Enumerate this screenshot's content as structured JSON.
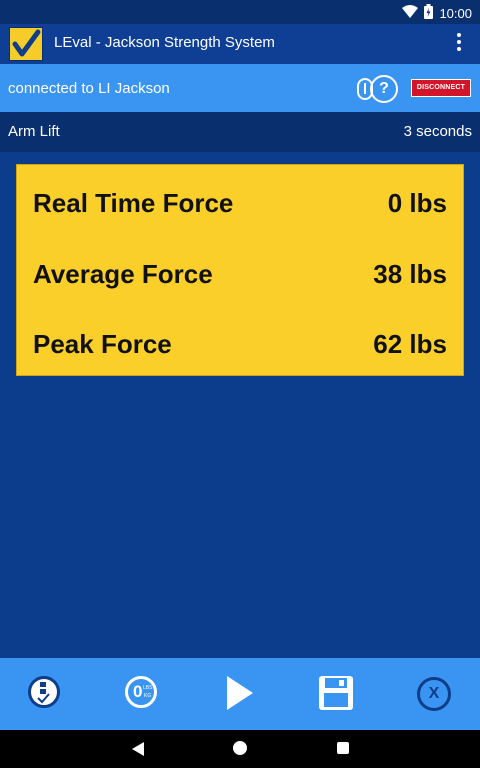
{
  "status_bar": {
    "time": "10:00"
  },
  "app_bar": {
    "title": "LEval - Jackson Strength System"
  },
  "connection_bar": {
    "status_text": "connected to LI Jackson",
    "help_label": "?",
    "disconnect_label": "DISCONNECT"
  },
  "test_bar": {
    "test_name": "Arm Lift",
    "duration": "3 seconds"
  },
  "force_panel": {
    "rows": [
      {
        "label": "Real Time Force",
        "value": "0 lbs"
      },
      {
        "label": "Average Force",
        "value": "38 lbs"
      },
      {
        "label": "Peak Force",
        "value": "62 lbs"
      }
    ]
  },
  "bottom_bar": {
    "zero_label": "0",
    "zero_unit_top": "LBS",
    "zero_unit_bottom": "KG",
    "close_label": "X"
  },
  "colors": {
    "appbar": "#0f3f95",
    "connbar": "#3a94f2",
    "background": "#0b3d8c",
    "panel": "#fbcf2a",
    "disconnect": "#d3152a"
  },
  "icons": [
    "wifi-icon",
    "battery-status-icon",
    "app-logo-check-icon",
    "overflow-menu-icon",
    "device-battery-icon",
    "help-icon",
    "select-test-icon",
    "zero-scale-icon",
    "play-icon",
    "save-icon",
    "close-icon",
    "back-icon",
    "home-icon",
    "recents-icon"
  ]
}
